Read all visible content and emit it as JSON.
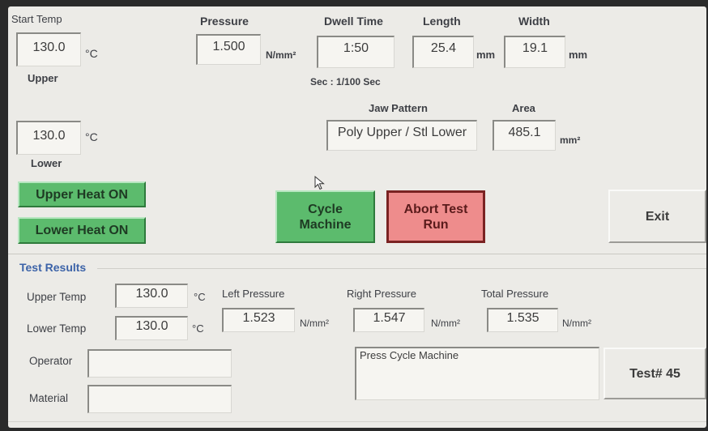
{
  "start_temp": {
    "label": "Start Temp",
    "upper_value": "130.0",
    "lower_value": "130.0",
    "unit": "°C",
    "upper_label": "Upper",
    "lower_label": "Lower"
  },
  "pressure": {
    "label": "Pressure",
    "value": "1.500",
    "unit": "N/mm²"
  },
  "dwell": {
    "label": "Dwell Time",
    "value": "1:50",
    "note": "Sec : 1/100 Sec"
  },
  "length": {
    "label": "Length",
    "value": "25.4",
    "unit": "mm"
  },
  "width": {
    "label": "Width",
    "value": "19.1",
    "unit": "mm"
  },
  "jaw": {
    "label": "Jaw Pattern",
    "value": "Poly Upper / Stl Lower"
  },
  "area": {
    "label": "Area",
    "value": "485.1",
    "unit": "mm²"
  },
  "buttons": {
    "upper_heat": "Upper Heat ON",
    "lower_heat": "Lower Heat ON",
    "cycle_l1": "Cycle",
    "cycle_l2": "Machine",
    "abort_l1": "Abort Test",
    "abort_l2": "Run",
    "exit": "Exit",
    "test": "Test# 45"
  },
  "results": {
    "title": "Test Results",
    "upper_temp_label": "Upper Temp",
    "upper_temp_value": "130.0",
    "lower_temp_label": "Lower Temp",
    "lower_temp_value": "130.0",
    "temp_unit": "°C",
    "left_pressure_label": "Left Pressure",
    "left_pressure_value": "1.523",
    "right_pressure_label": "Right Pressure",
    "right_pressure_value": "1.547",
    "total_pressure_label": "Total Pressure",
    "total_pressure_value": "1.535",
    "pressure_unit": "N/mm²"
  },
  "operator": {
    "label": "Operator",
    "value": ""
  },
  "material": {
    "label": "Material",
    "value": ""
  },
  "status_message": "Press Cycle Machine",
  "colors": {
    "start_button": "#5cbb6d",
    "abort_button": "#ee8c8c",
    "panel": "#ecebe7",
    "section_title": "#3c63a8"
  }
}
